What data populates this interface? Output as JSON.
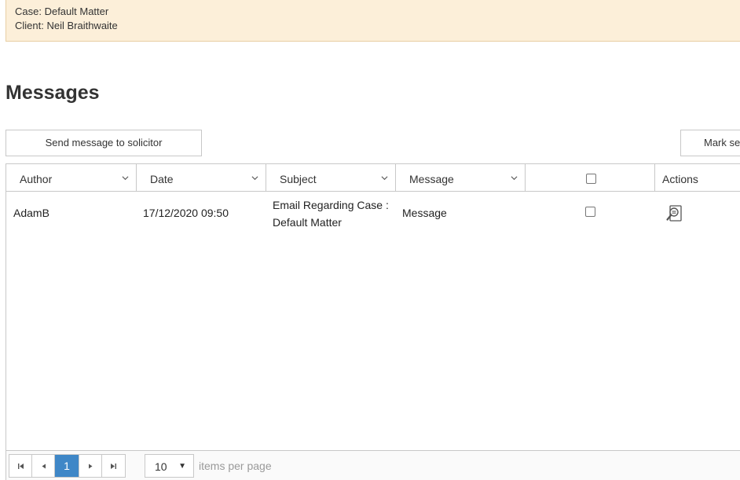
{
  "case_info": {
    "case_line": "Case: Default Matter",
    "client_line": "Client: Neil Braithwaite"
  },
  "page": {
    "title": "Messages"
  },
  "toolbar": {
    "send_label": "Send message to solicitor",
    "mark_label": "Mark se"
  },
  "grid": {
    "columns": {
      "author": "Author",
      "date": "Date",
      "subject": "Subject",
      "message": "Message",
      "actions": "Actions"
    },
    "header_select_all": false,
    "rows": [
      {
        "author": "AdamB",
        "date": "17/12/2020 09:50",
        "subject": "Email Regarding Case : Default Matter",
        "message": "Message",
        "selected": false,
        "action_icon": "view-message-icon"
      }
    ]
  },
  "pager": {
    "first_icon": "first-page-icon",
    "prev_icon": "previous-page-icon",
    "current_page": "1",
    "next_icon": "next-page-icon",
    "last_icon": "last-page-icon",
    "page_size": "10",
    "page_size_label": "items per page"
  },
  "colors": {
    "banner_bg": "#fcefd9",
    "banner_border": "#e8cfa4",
    "active_page": "#3f87c7"
  }
}
